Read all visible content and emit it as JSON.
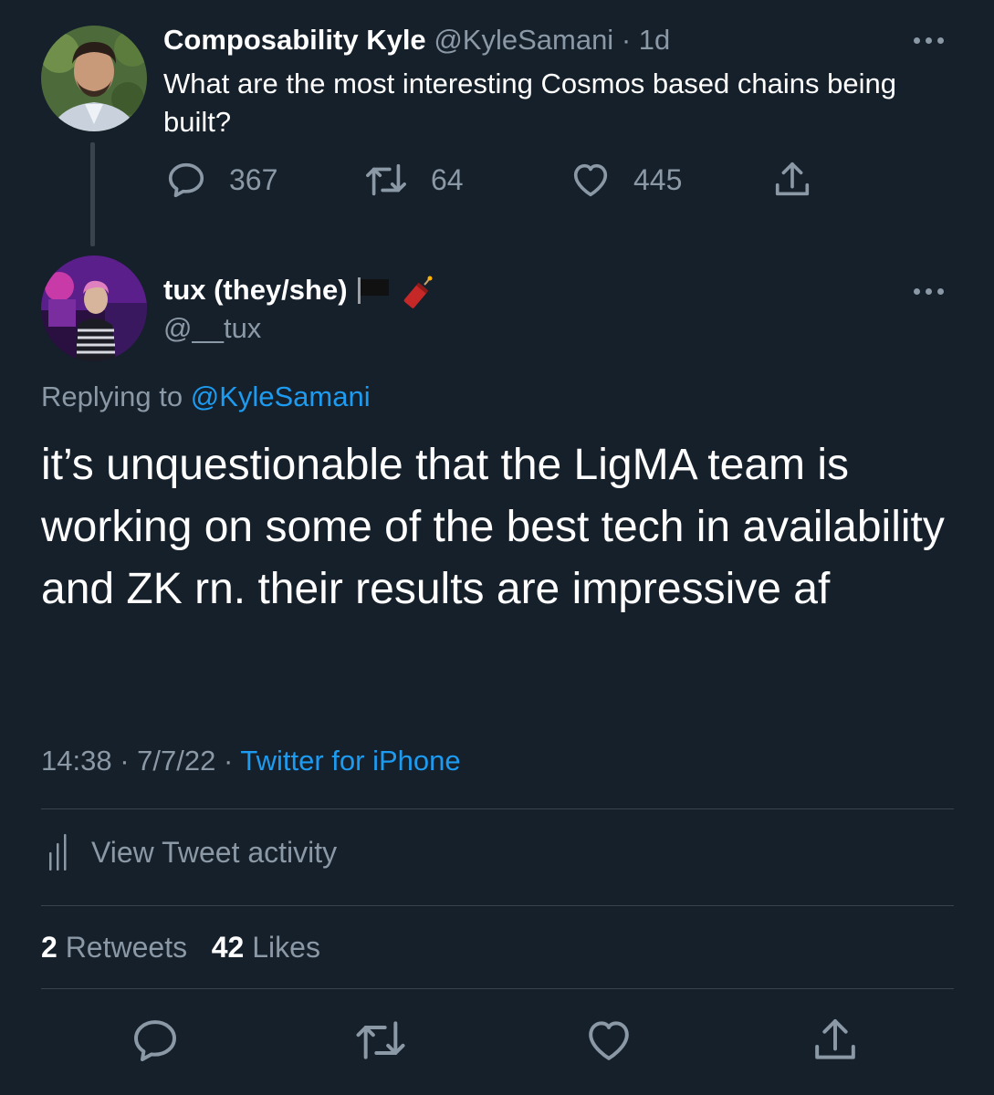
{
  "parent_tweet": {
    "display_name": "Composability Kyle",
    "handle": "@KyleSamani",
    "separator": "·",
    "age": "1d",
    "text": "What are the most interesting Cosmos based chains being built?",
    "reply_count": "367",
    "retweet_count": "64",
    "like_count": "445",
    "icons": [
      "reply-icon",
      "retweet-icon",
      "like-icon",
      "share-icon",
      "more-icon"
    ]
  },
  "main_tweet": {
    "display_name": "tux (they/she)",
    "name_emojis": [
      "black-flag-icon",
      "firecracker-icon"
    ],
    "handle": "@__tux",
    "replying_prefix": "Replying to",
    "replying_to": "@KyleSamani",
    "text": "it’s unquestionable that the LigMA team is working on some of the best tech in availability and ZK rn. their results are impressive af",
    "time": "14:38",
    "date": "7/7/22",
    "separator": "·",
    "source": "Twitter for iPhone",
    "activity_label": "View Tweet activity",
    "retweets_count": "2",
    "retweets_label": "Retweets",
    "likes_count": "42",
    "likes_label": "Likes"
  },
  "colors": {
    "background": "#15202b",
    "text": "#ffffff",
    "muted": "#8b98a5",
    "accent": "#1d9bf0",
    "divider": "#38444d"
  }
}
